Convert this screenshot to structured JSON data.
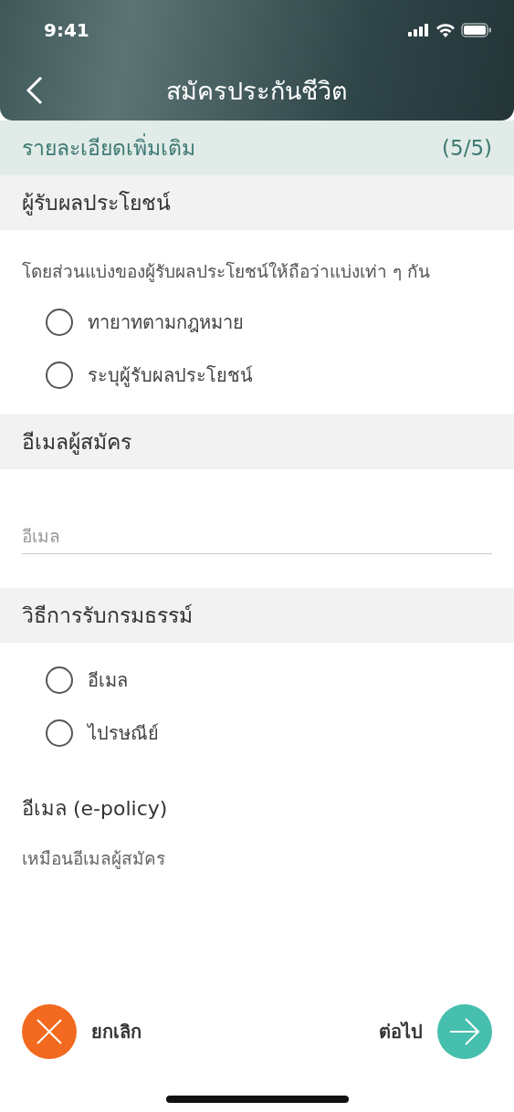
{
  "status_bar": {
    "time": "9:41"
  },
  "header": {
    "title": "สมัครประกันชีวิต"
  },
  "step_bar": {
    "title": "รายละเอียดเพิ่มเติม",
    "step": "(5/5)"
  },
  "sections": [
    {
      "kind": "radios",
      "title": "ผู้รับผลประโยชน์",
      "note": "โดยส่วนแบ่งของผู้รับผลประโยชน์ให้ถือว่าแบ่งเท่า ๆ กัน",
      "options": [
        {
          "label": "ทายาทตามกฎหมาย",
          "selected": false
        },
        {
          "label": "ระบุผู้รับผลประโยชน์",
          "selected": false
        }
      ]
    },
    {
      "kind": "field",
      "title": "อีเมลผู้สมัคร",
      "field": {
        "placeholder": "อีเมล"
      }
    },
    {
      "kind": "radios",
      "title": "วิธีการรับกรมธรรม์",
      "options": [
        {
          "label": "อีเมล",
          "selected": false
        },
        {
          "label": "ไปรษณีย์",
          "selected": false
        }
      ]
    }
  ],
  "policy_email": {
    "label": "อีเมล (e-policy)",
    "value": "เหมือนอีเมลผู้สมัคร"
  },
  "actions": [
    {
      "kind": "cancel",
      "label": "ยกเลิก"
    },
    {
      "kind": "next",
      "label": "ต่อไป"
    }
  ]
}
